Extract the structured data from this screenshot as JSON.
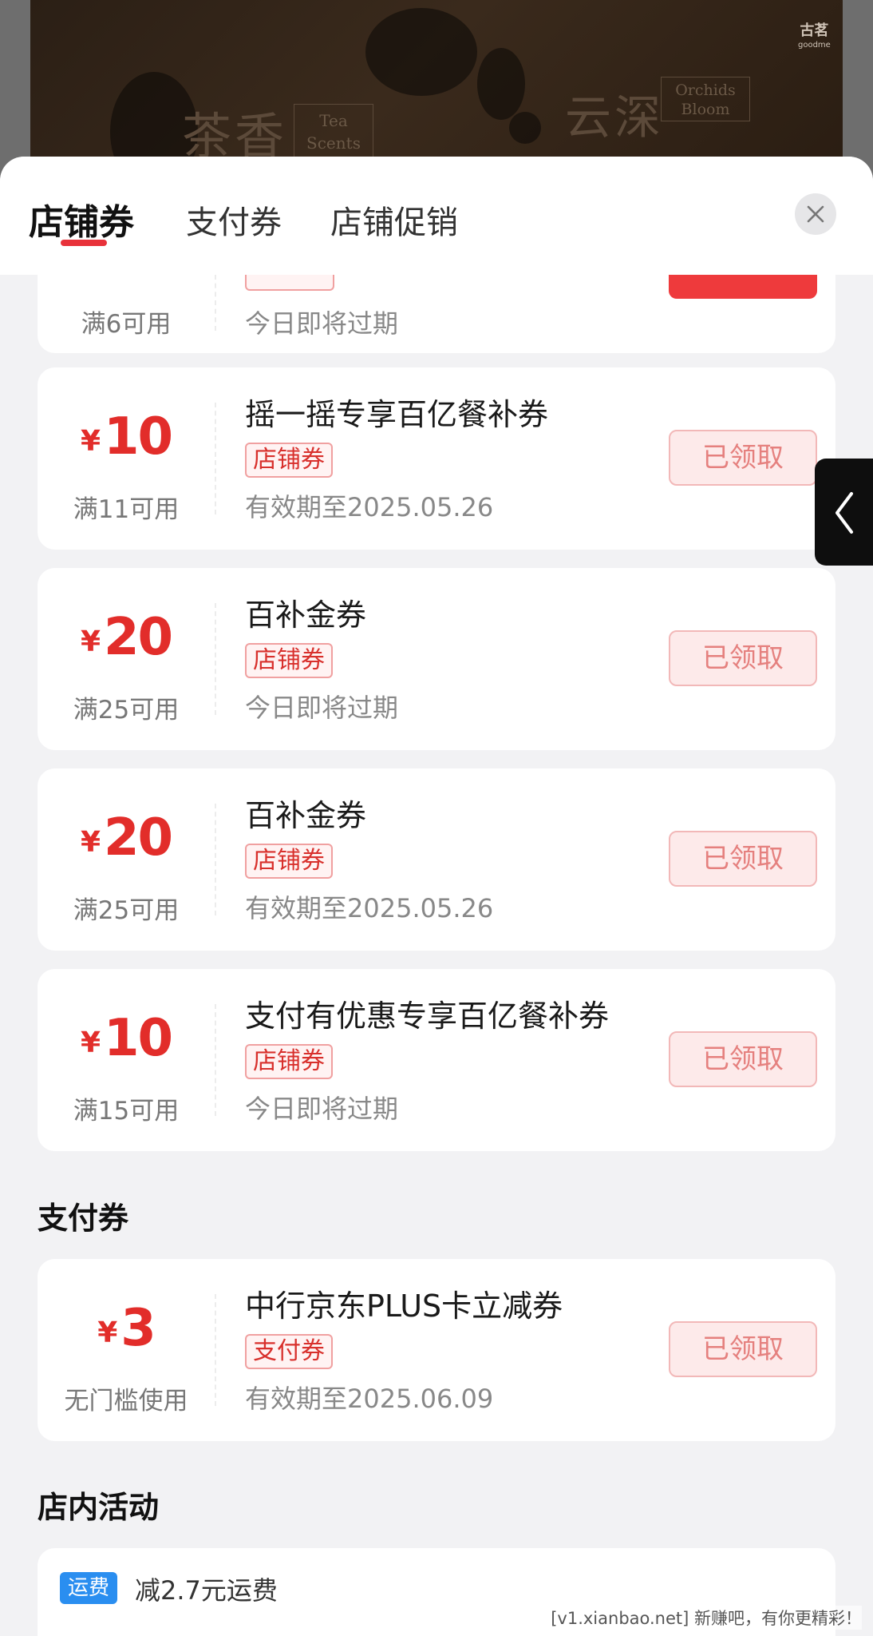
{
  "banner": {
    "title_left_cn": "茶香",
    "title_left_en_1": "Tea",
    "title_left_en_2": "Scents",
    "title_right_cn": "云深",
    "title_right_en_1": "Orchids",
    "title_right_en_2": "Bloom",
    "logo_cn": "古茗",
    "logo_en": "goodme"
  },
  "tabs": [
    {
      "label": "店铺券",
      "active": true
    },
    {
      "label": "支付券",
      "active": false
    },
    {
      "label": "店铺促销",
      "active": false
    }
  ],
  "partial_card": {
    "condition": "满6可用",
    "expiry": "今日即将过期"
  },
  "store_coupons": [
    {
      "currency": "¥",
      "amount": "10",
      "condition": "满11可用",
      "title": "摇一摇专享百亿餐补券",
      "tag": "店铺券",
      "expiry": "有效期至2025.05.26",
      "button": "已领取"
    },
    {
      "currency": "¥",
      "amount": "20",
      "condition": "满25可用",
      "title": "百补金券",
      "tag": "店铺券",
      "expiry": "今日即将过期",
      "button": "已领取"
    },
    {
      "currency": "¥",
      "amount": "20",
      "condition": "满25可用",
      "title": "百补金券",
      "tag": "店铺券",
      "expiry": "有效期至2025.05.26",
      "button": "已领取"
    },
    {
      "currency": "¥",
      "amount": "10",
      "condition": "满15可用",
      "title": "支付有优惠专享百亿餐补券",
      "tag": "店铺券",
      "expiry": "今日即将过期",
      "button": "已领取"
    }
  ],
  "payment_section": {
    "title": "支付券",
    "coupons": [
      {
        "currency": "¥",
        "amount": "3",
        "condition": "无门槛使用",
        "title": "中行京东PLUS卡立减券",
        "tag": "支付券",
        "expiry": "有效期至2025.06.09",
        "button": "已领取"
      }
    ]
  },
  "activity_section": {
    "title": "店内活动",
    "badge": "运费",
    "text": "减2.7元运费"
  },
  "watermark": "[v1.xianbao.net] 新赚吧，有你更精彩！",
  "colors": {
    "accent_red": "#e22d2a",
    "tab_underline": "#e8323a",
    "badge_blue": "#2a8ef0"
  }
}
